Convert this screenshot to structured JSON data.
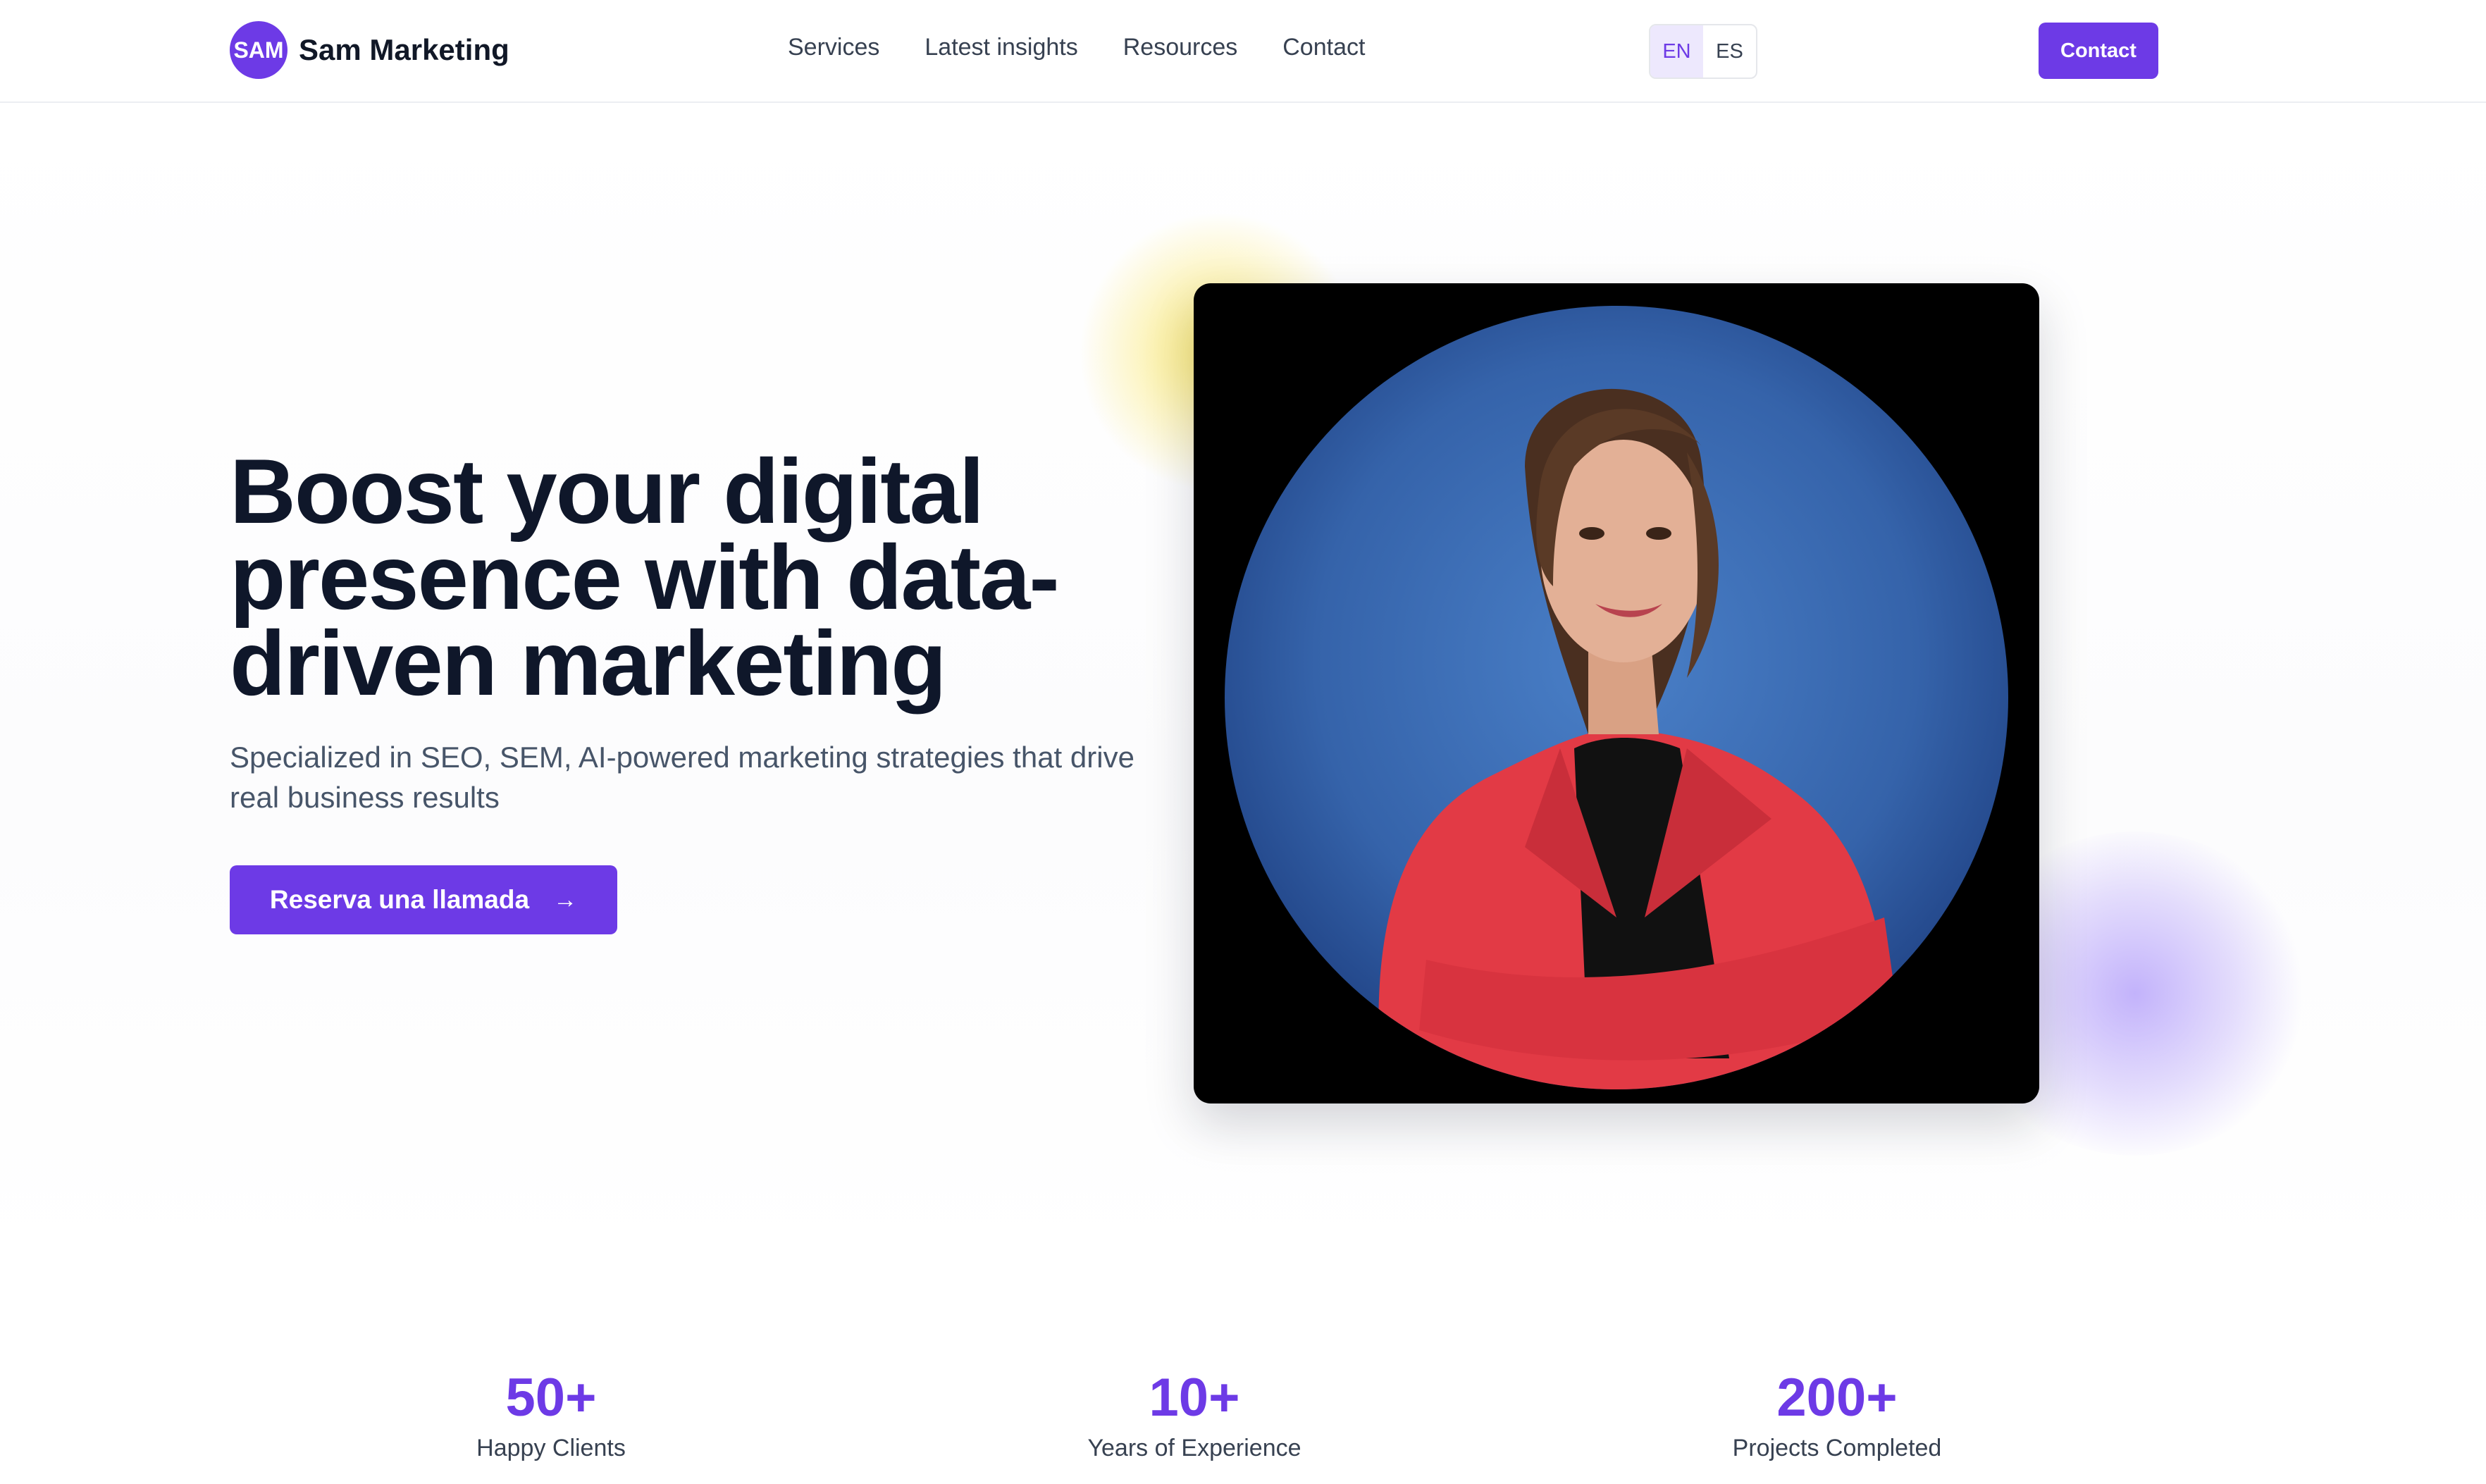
{
  "brand": {
    "badge": "SAM",
    "name": "Sam Marketing"
  },
  "nav": {
    "items": [
      "Services",
      "Latest insights",
      "Resources",
      "Contact"
    ]
  },
  "language": {
    "options": [
      "EN",
      "ES"
    ],
    "active": "EN"
  },
  "header": {
    "contact_label": "Contact"
  },
  "hero": {
    "headline": "Boost your digital presence with data-driven marketing",
    "subline": "Specialized in SEO, SEM, AI-powered marketing strategies that drive real business results",
    "cta_label": "Reserva una llamada",
    "cta_icon": "arrow-right-icon"
  },
  "stats": [
    {
      "value": "50+",
      "label": "Happy Clients"
    },
    {
      "value": "10+",
      "label": "Years of Experience"
    },
    {
      "value": "200+",
      "label": "Projects Completed"
    }
  ],
  "colors": {
    "accent": "#6d3ae6",
    "glow_yellow": "#fae55a",
    "glow_purple": "#b4a0fa",
    "photo_circle": "#3e6fb8",
    "blazer": "#e23a45"
  }
}
